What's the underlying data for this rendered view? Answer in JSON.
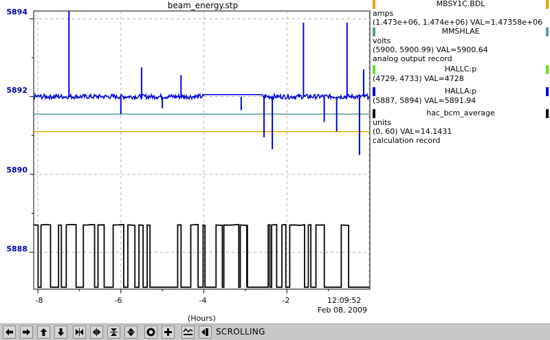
{
  "window_title": "beam_energy.stp",
  "colors": {
    "primary_series": "#0000dd",
    "teal_line": "#5b9a9a",
    "orange_line": "#f0a000",
    "black_series": "#000000",
    "grid": "#b0b0b0"
  },
  "chart_data": {
    "type": "line",
    "x_axis_label": "(Hours)",
    "x_ticks": [
      "-8",
      "-6",
      "-4",
      "-2"
    ],
    "time_label": "12:09:52",
    "date_label": "Feb 08, 2009",
    "y_ticks": [
      "5894",
      "5892",
      "5890",
      "5888"
    ],
    "ylim": [
      5887.05,
      5894.2
    ],
    "xlim": [
      -8.1,
      0
    ],
    "grid": true,
    "series": [
      {
        "name": "HALLA:p",
        "color": "#0000dd",
        "baseline": 5892.0,
        "spikes": [
          [
            -7.25,
            5894.2
          ],
          [
            -6.0,
            5891.55
          ],
          [
            -5.5,
            5892.75
          ],
          [
            -5.0,
            5891.7
          ],
          [
            -4.55,
            5892.55
          ],
          [
            -3.1,
            5891.65
          ],
          [
            -2.55,
            5890.95
          ],
          [
            -2.35,
            5890.65
          ],
          [
            -1.6,
            5893.9
          ],
          [
            -1.1,
            5891.35
          ],
          [
            -0.8,
            5891.1
          ],
          [
            -0.55,
            5893.9
          ],
          [
            -0.25,
            5890.5
          ],
          [
            -0.15,
            5892.7
          ]
        ],
        "flat_segment": [
          -4.0,
          -2.6,
          5892.05
        ]
      },
      {
        "name": "MMSHLAE",
        "color": "#5b9a9a",
        "constant": 5891.55
      },
      {
        "name": "MBSY1C.BDL",
        "color": "#f0a000",
        "constant": 5891.1
      },
      {
        "name": "hac_bcm_average",
        "color": "#000000",
        "high": 5888.7,
        "low": 5887.1
      }
    ]
  },
  "legend": [
    {
      "title": "MBSY1C.BDL",
      "color": "#f0a000",
      "lines": [
        "amps",
        "(1.473e+06, 1.474e+06)  VAL=1.47358e+06"
      ]
    },
    {
      "title": "MMSHLAE",
      "color": "#5b9a9a",
      "lines": [
        "volts",
        "(5900, 5900.99)  VAL=5900.64",
        "analog output record"
      ]
    },
    {
      "title": "HALLC:p",
      "color": "#66dd22",
      "lines": [
        "(4729, 4733) VAL=4728"
      ]
    },
    {
      "title": "HALLA:p",
      "color": "#0000dd",
      "lines": [
        "(5887, 5894) VAL=5891.94"
      ]
    },
    {
      "title": "hac_bcm_average",
      "color": "#000000",
      "lines": [
        "units",
        "(0, 60) VAL=14.1431",
        "calculation record"
      ]
    }
  ],
  "toolbar": {
    "buttons": [
      "arrow-left-icon",
      "arrow-right-icon",
      "arrow-up-icon",
      "arrow-down-icon",
      "zoom-in-horizontal-icon",
      "zoom-out-horizontal-icon",
      "zoom-in-vertical-icon",
      "zoom-out-vertical-icon",
      "reset-icon",
      "add-icon",
      "auto-scale-icon",
      "scroll-toggle-icon"
    ],
    "scroll_label": "SCROLLING"
  }
}
